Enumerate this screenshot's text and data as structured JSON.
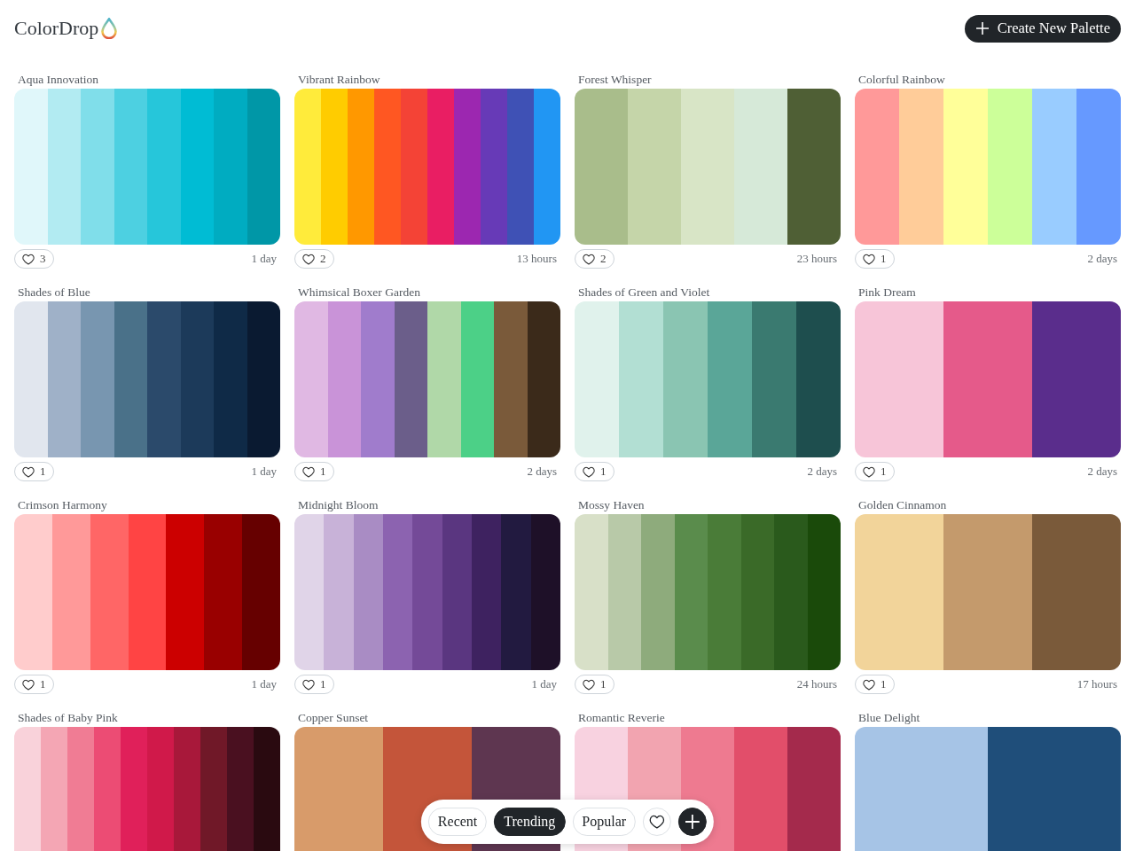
{
  "header": {
    "logo": "ColorDrop",
    "create_button": "Create New Palette"
  },
  "palettes": [
    {
      "title": "Aqua Innovation",
      "swatches": [
        {
          "color": "#e0f7fa"
        },
        {
          "color": "#b2ebf2"
        },
        {
          "color": "#80deea"
        },
        {
          "color": "#4dd0e1"
        },
        {
          "color": "#26c6da"
        },
        {
          "color": "#00bcd4"
        },
        {
          "color": "#00acc1"
        },
        {
          "color": "#0097a7"
        }
      ],
      "likes": "3",
      "age": "1 day"
    },
    {
      "title": "Vibrant Rainbow",
      "swatches": [
        {
          "color": "#ffeb3b"
        },
        {
          "color": "#ffcc00"
        },
        {
          "color": "#ff9800"
        },
        {
          "color": "#ff5722"
        },
        {
          "color": "#f44336"
        },
        {
          "color": "#e91e63"
        },
        {
          "color": "#9c27b0"
        },
        {
          "color": "#673ab7"
        },
        {
          "color": "#3f51b5"
        },
        {
          "color": "#2196f3"
        }
      ],
      "likes": "2",
      "age": "13 hours"
    },
    {
      "title": "Forest Whisper",
      "swatches": [
        {
          "color": "#a9bd8b"
        },
        {
          "color": "#c5d5a9"
        },
        {
          "color": "#d8e5c6"
        },
        {
          "color": "#d6e9d8"
        },
        {
          "color": "#4f5f35"
        }
      ],
      "likes": "2",
      "age": "23 hours"
    },
    {
      "title": "Colorful Rainbow",
      "swatches": [
        {
          "color": "#ff9999"
        },
        {
          "color": "#ffcc99"
        },
        {
          "color": "#ffff99"
        },
        {
          "color": "#ccff99"
        },
        {
          "color": "#99ccff"
        },
        {
          "color": "#6699ff"
        }
      ],
      "likes": "1",
      "age": "2 days"
    },
    {
      "title": "Shades of Blue",
      "swatches": [
        {
          "color": "#e1e6ee"
        },
        {
          "color": "#9fb1c8"
        },
        {
          "color": "#7896b0"
        },
        {
          "color": "#4a7189"
        },
        {
          "color": "#2b4a6b"
        },
        {
          "color": "#1c3a5a"
        },
        {
          "color": "#0f2a47"
        },
        {
          "color": "#0a1a31"
        }
      ],
      "likes": "1",
      "age": "1 day"
    },
    {
      "title": "Whimsical Boxer Garden",
      "swatches": [
        {
          "color": "#e0b8e3"
        },
        {
          "color": "#c993d8"
        },
        {
          "color": "#a07ccc"
        },
        {
          "color": "#6b5e8a"
        },
        {
          "color": "#b0d8a8"
        },
        {
          "color": "#4cd087"
        },
        {
          "color": "#7a5a3a"
        },
        {
          "color": "#3b2a1a"
        }
      ],
      "likes": "1",
      "age": "2 days"
    },
    {
      "title": "Shades of Green and Violet",
      "swatches": [
        {
          "color": "#e0f2ec"
        },
        {
          "color": "#b2dfd3"
        },
        {
          "color": "#8ac5b2"
        },
        {
          "color": "#5aa698"
        },
        {
          "color": "#3a7a70"
        },
        {
          "color": "#1e4e4e"
        }
      ],
      "likes": "1",
      "age": "2 days"
    },
    {
      "title": "Pink Dream",
      "swatches": [
        {
          "color": "#f7c5d8"
        },
        {
          "color": "#e55a8a"
        },
        {
          "color": "#5a2d8c"
        }
      ],
      "likes": "1",
      "age": "2 days"
    },
    {
      "title": "Crimson Harmony",
      "swatches": [
        {
          "color": "#ffcccc"
        },
        {
          "color": "#ff9999"
        },
        {
          "color": "#ff6666"
        },
        {
          "color": "#ff4444"
        },
        {
          "color": "#cc0000"
        },
        {
          "color": "#990000"
        },
        {
          "color": "#660000"
        }
      ],
      "likes": "1",
      "age": "1 day"
    },
    {
      "title": "Midnight Bloom",
      "swatches": [
        {
          "color": "#e0d4e8"
        },
        {
          "color": "#c8b2d8"
        },
        {
          "color": "#a98cc4"
        },
        {
          "color": "#8c63b0"
        },
        {
          "color": "#744a98"
        },
        {
          "color": "#5a3680"
        },
        {
          "color": "#3e2260"
        },
        {
          "color": "#221a40"
        },
        {
          "color": "#1e1028"
        }
      ],
      "likes": "1",
      "age": "1 day"
    },
    {
      "title": "Mossy Haven",
      "swatches": [
        {
          "color": "#d8e0c8"
        },
        {
          "color": "#b8c9a8"
        },
        {
          "color": "#8eab7c"
        },
        {
          "color": "#5a8c4c"
        },
        {
          "color": "#4a7c38"
        },
        {
          "color": "#3a6a28"
        },
        {
          "color": "#2a5a1c"
        },
        {
          "color": "#1a4a0a"
        }
      ],
      "likes": "1",
      "age": "24 hours"
    },
    {
      "title": "Golden Cinnamon",
      "swatches": [
        {
          "color": "#f2d49a"
        },
        {
          "color": "#c49a6c"
        },
        {
          "color": "#7a5a3a"
        }
      ],
      "likes": "1",
      "age": "17 hours"
    },
    {
      "title": "Shades of Baby Pink",
      "swatches": [
        {
          "color": "#f9d2da"
        },
        {
          "color": "#f4a6b4"
        },
        {
          "color": "#f07c94"
        },
        {
          "color": "#ec4c74"
        },
        {
          "color": "#e0205a"
        },
        {
          "color": "#d0194a"
        },
        {
          "color": "#a8183a"
        },
        {
          "color": "#701828"
        },
        {
          "color": "#4a1020"
        },
        {
          "color": "#2a0a10"
        }
      ]
    },
    {
      "title": "Copper Sunset",
      "swatches": [
        {
          "color": "#d89b6a"
        },
        {
          "color": "#c4553a"
        },
        {
          "color": "#5e3650"
        }
      ]
    },
    {
      "title": "Romantic Reverie",
      "swatches": [
        {
          "color": "#f8d2e0"
        },
        {
          "color": "#f2a4b0"
        },
        {
          "color": "#ee7a90"
        },
        {
          "color": "#e24e6a"
        },
        {
          "color": "#a42a4c"
        }
      ]
    },
    {
      "title": "Blue Delight",
      "swatches": [
        {
          "color": "#a6c4e6"
        },
        {
          "color": "#1f4e7a"
        }
      ]
    }
  ],
  "nav": {
    "tabs": [
      {
        "label": "Recent",
        "selected": false
      },
      {
        "label": "Trending",
        "selected": true
      },
      {
        "label": "Popular",
        "selected": false
      }
    ]
  }
}
